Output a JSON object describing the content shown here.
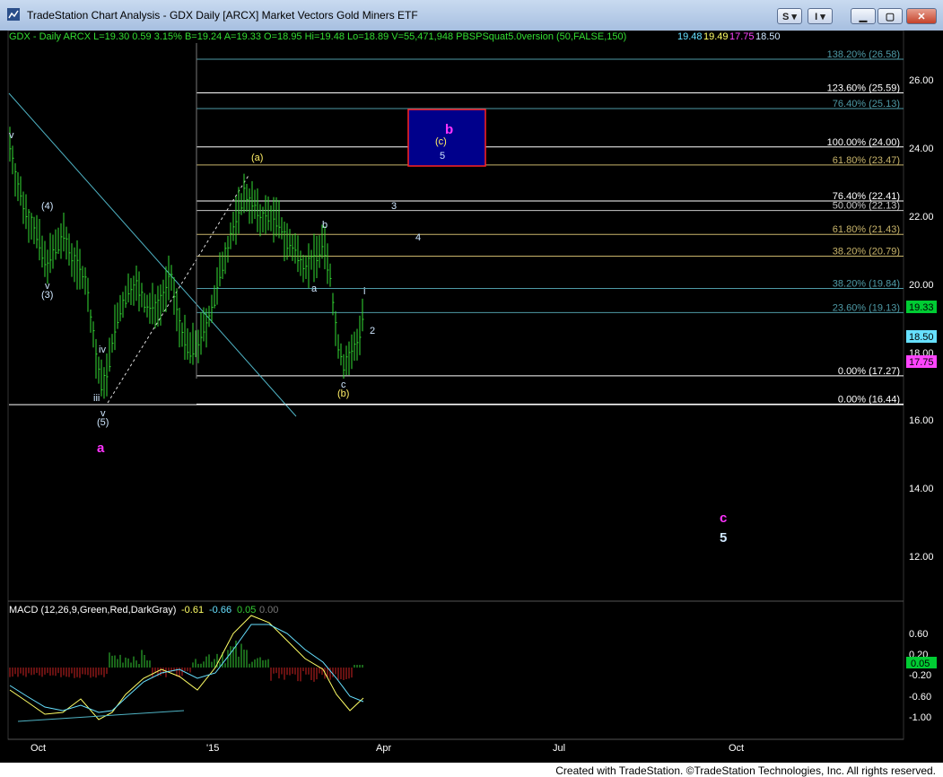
{
  "window": {
    "title": "TradeStation Chart Analysis - GDX Daily [ARCX] Market Vectors Gold Miners ETF",
    "buttons": {
      "s": "S",
      "i": "I"
    }
  },
  "header": {
    "symbol_line": "GDX - Daily  ARCX  L=19.30  0.59  3.15%  B=19.24  A=19.33  O=18.95  Hi=19.48  Lo=18.89  V=55,471,948  PBSPSquat5.0version (50,FALSE,150)",
    "indicator_values": [
      "19.48",
      "19.49",
      "17.75",
      "18.50"
    ],
    "indicator_colors": [
      "#66e0ff",
      "#ffff66",
      "#ff44ff",
      "#cfe7ff"
    ]
  },
  "macd": {
    "label": "MACD (12,26,9,Green,Red,DarkGray)",
    "values": [
      "-0.61",
      "-0.66",
      "0.05",
      "0.00"
    ],
    "value_colors": [
      "#ffff66",
      "#66e0ff",
      "#33cc33",
      "#777777"
    ]
  },
  "x_labels": [
    "Oct",
    "'15",
    "Apr",
    "Jul",
    "Oct"
  ],
  "credit": "Created with TradeStation. ©TradeStation Technologies, Inc. All rights reserved.",
  "chart_data": {
    "type": "candlestick",
    "price_axis": {
      "ticks": [
        "26.00",
        "24.00",
        "22.00",
        "20.00",
        "18.00",
        "16.00",
        "14.00",
        "12.00"
      ],
      "range": [
        11,
        27
      ]
    },
    "price_tags": [
      {
        "text": "19.33",
        "value": 19.33,
        "color": "#00cc33"
      },
      {
        "text": "18.50",
        "value": 18.5,
        "color": "#66e0ff"
      },
      {
        "text": "17.75",
        "value": 17.75,
        "color": "#ff44ff"
      }
    ],
    "fib_levels": [
      {
        "label": "138.20% (26.58)",
        "value": 26.58,
        "color": "#4e9aa6"
      },
      {
        "label": "123.60% (25.59)",
        "value": 25.59,
        "color": "#ffffff"
      },
      {
        "label": "76.40% (25.13)",
        "value": 25.13,
        "color": "#4e9aa6"
      },
      {
        "label": "100.00% (24.00)",
        "value": 24.0,
        "color": "#ffffff"
      },
      {
        "label": "61.80% (23.47)",
        "value": 23.47,
        "color": "#c8b46a"
      },
      {
        "label": "76.40% (22.41)",
        "value": 22.41,
        "color": "#ffffff"
      },
      {
        "label": "50.00% (22.13)",
        "value": 22.13,
        "color": "#c8c8c8"
      },
      {
        "label": "61.80% (21.43)",
        "value": 21.43,
        "color": "#c8b46a"
      },
      {
        "label": "38.20% (20.79)",
        "value": 20.79,
        "color": "#c8b46a"
      },
      {
        "label": "38.20% (19.84)",
        "value": 19.84,
        "color": "#4e9aa6"
      },
      {
        "label": "23.60% (19.13)",
        "value": 19.13,
        "color": "#4e9aa6"
      },
      {
        "label": "0.00% (17.27)",
        "value": 17.27,
        "color": "#ffffff"
      },
      {
        "label": "0.00% (16.44)",
        "value": 16.44,
        "color": "#ffffff"
      }
    ],
    "wave_labels": [
      {
        "text": "v",
        "color": "#cfe7ff"
      },
      {
        "text": "(4)",
        "color": "#cfe7ff"
      },
      {
        "text": "v",
        "color": "#cfe7ff"
      },
      {
        "text": "(3)",
        "color": "#cfe7ff"
      },
      {
        "text": "iv",
        "color": "#cfe7ff"
      },
      {
        "text": "iii",
        "color": "#cfe7ff"
      },
      {
        "text": "v",
        "color": "#cfe7ff"
      },
      {
        "text": "(5)",
        "color": "#cfe7ff"
      },
      {
        "text": "a",
        "color": "#ff33ff"
      },
      {
        "text": "(a)",
        "color": "#ffee66"
      },
      {
        "text": "b",
        "color": "#cfe7ff"
      },
      {
        "text": "a",
        "color": "#cfe7ff"
      },
      {
        "text": "c",
        "color": "#cfe7ff"
      },
      {
        "text": "(b)",
        "color": "#ffee66"
      },
      {
        "text": "i",
        "color": "#cfe7ff"
      },
      {
        "text": "2",
        "color": "#cfe7ff"
      },
      {
        "text": "3",
        "color": "#cfe7ff"
      },
      {
        "text": "4",
        "color": "#cfe7ff"
      },
      {
        "text": "b",
        "color": "#ff33ff"
      },
      {
        "text": "(c)",
        "color": "#ffee66"
      },
      {
        "text": "5",
        "color": "#cfe7ff"
      },
      {
        "text": "c",
        "color": "#ff33ff"
      },
      {
        "text": "5",
        "color": "#cfe7ff"
      }
    ],
    "macd_axis": {
      "ticks": [
        "0.60",
        "0.20",
        "-0.20",
        "-0.60",
        "-1.00"
      ],
      "current": "0.05",
      "current_color": "#00cc33"
    }
  }
}
